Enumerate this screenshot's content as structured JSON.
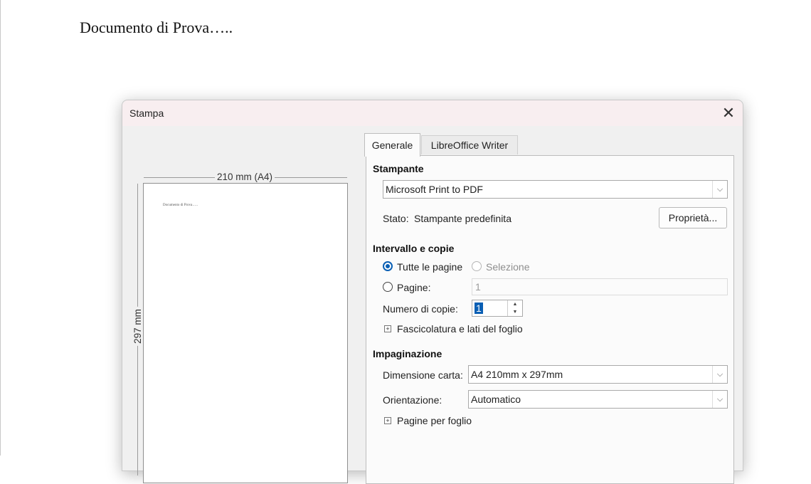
{
  "document": {
    "text": "Documento di Prova….."
  },
  "dialog": {
    "title": "Stampa",
    "close_icon": "close-icon",
    "preview": {
      "width_label": "210 mm (A4)",
      "height_label": "297 mm",
      "page_text": "Documento di Prova….."
    },
    "tabs": [
      {
        "label": "Generale",
        "active": true
      },
      {
        "label": "LibreOffice Writer",
        "active": false
      }
    ],
    "printer": {
      "section_label": "Stampante",
      "selected": "Microsoft Print to PDF",
      "status_label": "Stato:",
      "status_value": "Stampante predefinita",
      "properties_button": "Proprietà..."
    },
    "range": {
      "section_label": "Intervallo e copie",
      "all_pages_label": "Tutte le pagine",
      "selection_label": "Selezione",
      "pages_label": "Pagine:",
      "pages_value": "1",
      "copies_label": "Numero di copie:",
      "copies_value": "1",
      "collate_label": "Fascicolatura e lati del foglio"
    },
    "layout": {
      "section_label": "Impaginazione",
      "paper_size_label": "Dimensione carta:",
      "paper_size_value": "A4 210mm x 297mm",
      "orientation_label": "Orientazione:",
      "orientation_value": "Automatico",
      "pages_per_sheet_label": "Pagine per foglio"
    }
  }
}
